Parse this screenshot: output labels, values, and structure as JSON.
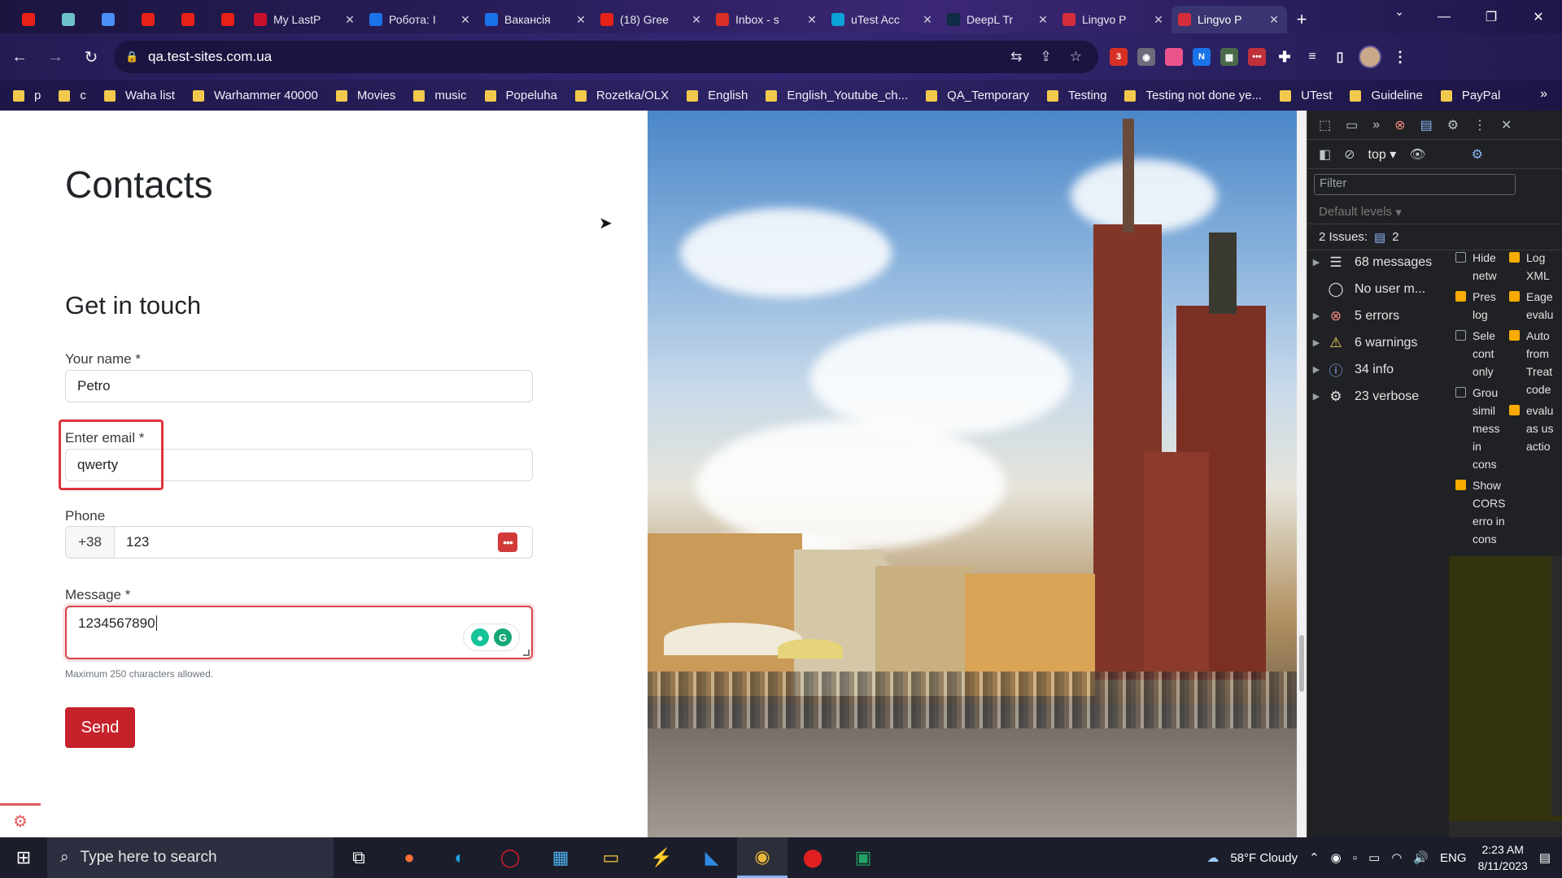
{
  "browser": {
    "tabs": [
      {
        "title": "",
        "favicon_color": "#e62117",
        "pinned": true
      },
      {
        "title": "",
        "favicon_color": "#6ec1c8",
        "pinned": true
      },
      {
        "title": "",
        "favicon_color": "#4a8ff7",
        "pinned": true
      },
      {
        "title": "",
        "favicon_color": "#e62117",
        "pinned": true
      },
      {
        "title": "",
        "favicon_color": "#e62117",
        "pinned": true
      },
      {
        "title": "",
        "favicon_color": "#e62117",
        "pinned": true
      },
      {
        "title": "My LastP",
        "favicon_color": "#c8102e"
      },
      {
        "title": "Робота: І",
        "favicon_color": "#1a73e8"
      },
      {
        "title": "Вакансія",
        "favicon_color": "#1a73e8"
      },
      {
        "title": "(18) Gree",
        "favicon_color": "#e62117"
      },
      {
        "title": "Inbox - s",
        "favicon_color": "#d93025"
      },
      {
        "title": "uTest Acc",
        "favicon_color": "#0aa3d8"
      },
      {
        "title": "DeepL Tr",
        "favicon_color": "#0f2b46"
      },
      {
        "title": "Lingvo P",
        "favicon_color": "#d42d3b"
      },
      {
        "title": "Lingvo P",
        "favicon_color": "#d42d3b",
        "active": true
      }
    ],
    "url": "qa.test-sites.com.ua",
    "bookmarks": [
      "p",
      "c",
      "Waha list",
      "Warhammer 40000",
      "Movies",
      "music",
      "Popeluha",
      "Rozetka/OLX",
      "English",
      "English_Youtube_ch...",
      "QA_Temporary",
      "Testing",
      "Testing not done ye...",
      "UTest",
      "Guideline",
      "PayPal"
    ]
  },
  "page": {
    "title": "Contacts",
    "section_title": "Get in touch",
    "name_label": "Your name *",
    "name_value": "Petro",
    "email_label": "Enter email *",
    "email_value": "qwerty",
    "phone_label": "Phone",
    "phone_prefix": "+38",
    "phone_value": "123",
    "message_label": "Message *",
    "message_value": "1234567890",
    "message_hint": "Maximum 250 characters allowed.",
    "send_label": "Send"
  },
  "devtools": {
    "context": "top",
    "filter_placeholder": "Filter",
    "levels": "Default levels",
    "issues_label": "2 Issues:",
    "issues_count": "2",
    "sidebar": [
      {
        "label": "68 messages",
        "icon": "list-icon"
      },
      {
        "label": "No user m...",
        "icon": "user-icon"
      },
      {
        "label": "5 errors",
        "icon": "error-icon"
      },
      {
        "label": "6 warnings",
        "icon": "warning-icon"
      },
      {
        "label": "34 info",
        "icon": "info-icon"
      },
      {
        "label": "23 verbose",
        "icon": "verbose-icon"
      }
    ],
    "settings_left": [
      {
        "text": "Hide netw",
        "checked": false
      },
      {
        "text": "Pres log",
        "checked": true
      },
      {
        "text": "Sele cont only",
        "checked": false
      },
      {
        "text": "Grou simil mess in cons",
        "checked": false
      },
      {
        "text": "Show CORS erro in cons",
        "checked": true
      }
    ],
    "settings_right": [
      {
        "text": "Log XML",
        "checked": true
      },
      {
        "text": "Eage evalu",
        "checked": true
      },
      {
        "text": "Auto from Treat code",
        "checked": true
      },
      {
        "text": "evalu as us actio",
        "checked": true
      }
    ]
  },
  "taskbar": {
    "search_placeholder": "Type here to search",
    "weather": "58°F  Cloudy",
    "lang": "ENG",
    "time": "2:23 AM",
    "date": "8/11/2023"
  }
}
